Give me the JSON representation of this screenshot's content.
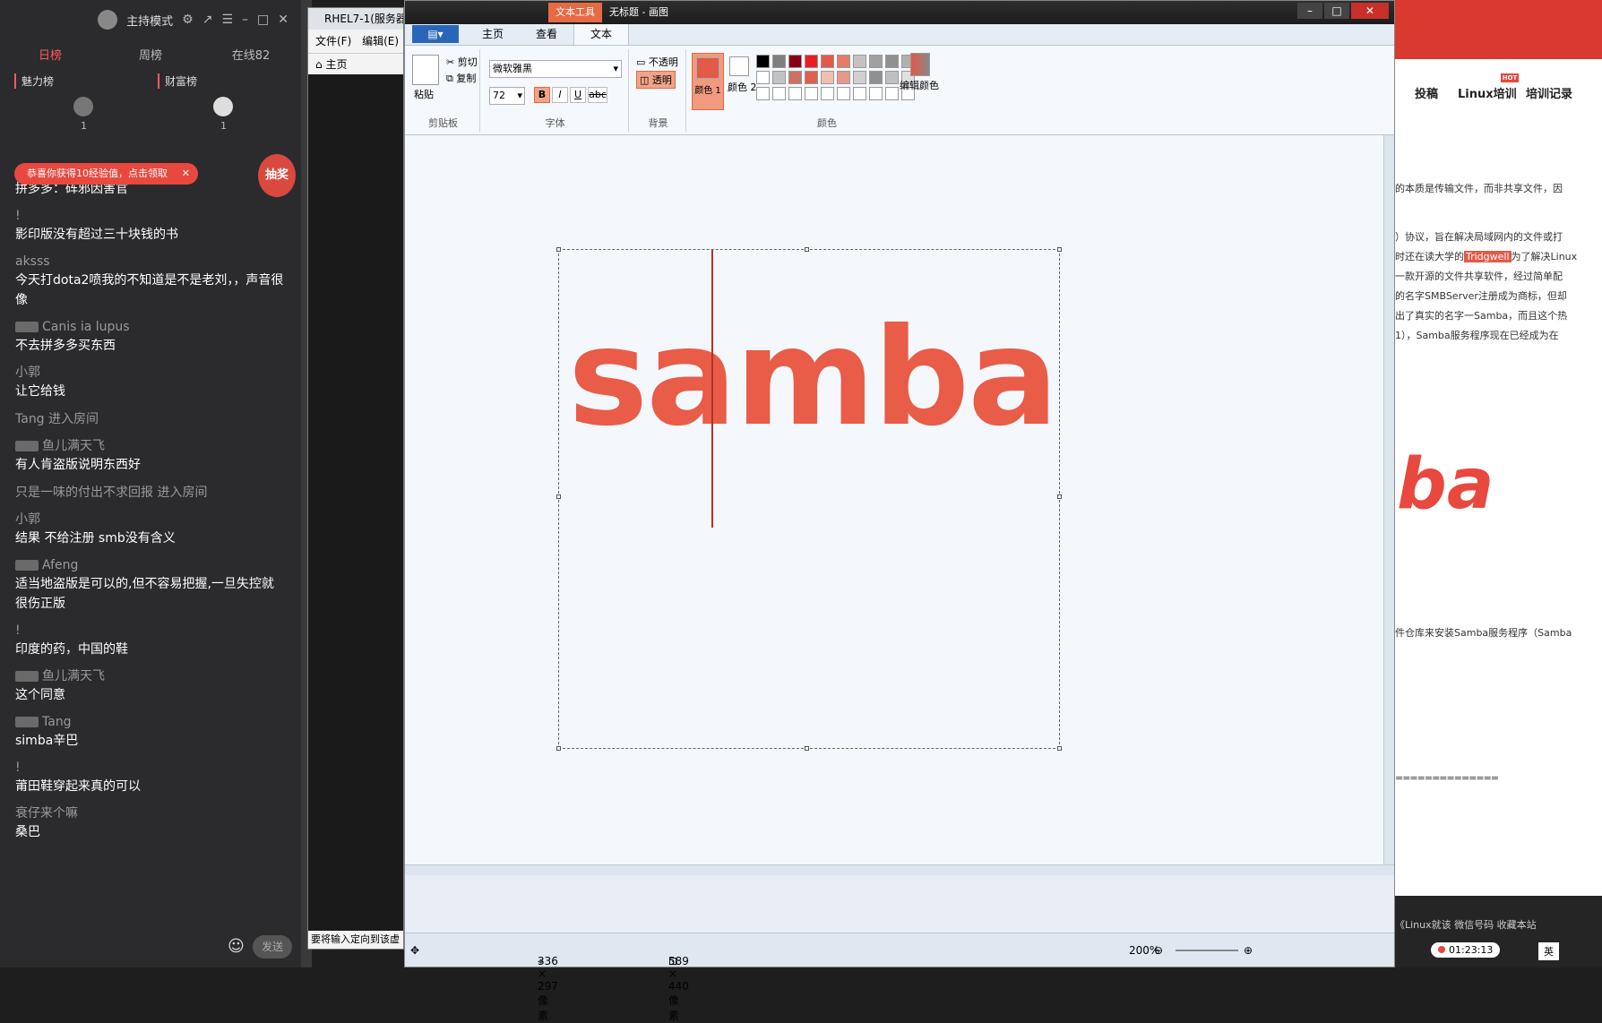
{
  "chat": {
    "mode_label": "主持模式",
    "tabs": [
      "日榜",
      "周榜",
      "在线82"
    ],
    "ranks": [
      "魅力榜",
      "财富榜"
    ],
    "rank_counts": [
      "1",
      "1"
    ],
    "toast": "恭喜你获得10经验值，点击领取",
    "lottery_label": "抽奖",
    "messages": [
      {
        "user": "",
        "text": "拼多多：砗邪因害官"
      },
      {
        "user": "!",
        "text": "影印版没有超过三十块钱的书"
      },
      {
        "user": "aksss",
        "text": "今天打dota2喷我的不知道是不是老刘，，声音很像"
      },
      {
        "user": "Canis ia lupus",
        "text": "不去拼多多买东西"
      },
      {
        "user": "小郭",
        "text": "让它给钱"
      },
      {
        "user": "",
        "system": "Tang 进入房间"
      },
      {
        "user": "鱼儿满天飞",
        "text": "有人肯盗版说明东西好"
      },
      {
        "user": "",
        "system": "只是一味的付出不求回报 进入房间"
      },
      {
        "user": "小郭",
        "text": "结果 不给注册 smb没有含义"
      },
      {
        "user": "Afeng",
        "text": "适当地盗版是可以的,但不容易把握,一旦失控就很伤正版"
      },
      {
        "user": "!",
        "text": "印度的药，中国的鞋"
      },
      {
        "user": "鱼儿满天飞",
        "text": "这个同意"
      },
      {
        "user": "Tang",
        "text": "simba辛巴"
      },
      {
        "user": "!",
        "text": "莆田鞋穿起来真的可以"
      },
      {
        "user": "衰仔来个嘛",
        "text": "桑巴"
      }
    ],
    "send_label": "发送"
  },
  "rhel": {
    "title": "RHEL7-1(服务器",
    "menu": [
      "文件(F)",
      "编辑(E)"
    ],
    "home_tab": "主页",
    "status": "要将输入定向到该虚"
  },
  "paint": {
    "context_tab": "文本工具",
    "window_title": "无标题 - 画图",
    "tabs": [
      "主页",
      "查看",
      "文本"
    ],
    "clipboard": {
      "paste": "粘贴",
      "cut": "剪切",
      "copy": "复制",
      "label": "剪贴板"
    },
    "font": {
      "name": "微软雅黑",
      "size": "72",
      "label": "字体"
    },
    "background": {
      "opaque": "不透明",
      "transparent": "透明",
      "label": "背景"
    },
    "colors": {
      "color1": "颜色 1",
      "color2": "颜色 2",
      "edit": "编辑颜色",
      "label": "颜色"
    },
    "canvas_text": "samba",
    "status": {
      "cursor": "336 × 297像素",
      "size": "589 × 440像素",
      "zoom": "200%"
    }
  },
  "web": {
    "nav": [
      "投稿",
      "Linux培训",
      "培训记录"
    ],
    "hot_badge": "HOT",
    "paragraphs": [
      "的本质是传输文件，而非共享文件，因",
      "）协议，旨在解决局域网内的文件或打",
      "时还在读大学的",
      "为了解决Linux",
      "一款开源的文件共享软件，经过简单配",
      "的名字SMBServer注册成为商标，但却",
      "出了真实的名字一Samba，而且这个热",
      "1），Samba服务程序现在已经成为在",
      "件仓库来安装Samba服务程序（Samba"
    ],
    "highlight": "Tridgwell",
    "logo_text": "ba",
    "rule": "==============",
    "footer_links": "《Linux就该  微信号码  收藏本站",
    "timer": "01:23:13",
    "lang": "英"
  }
}
